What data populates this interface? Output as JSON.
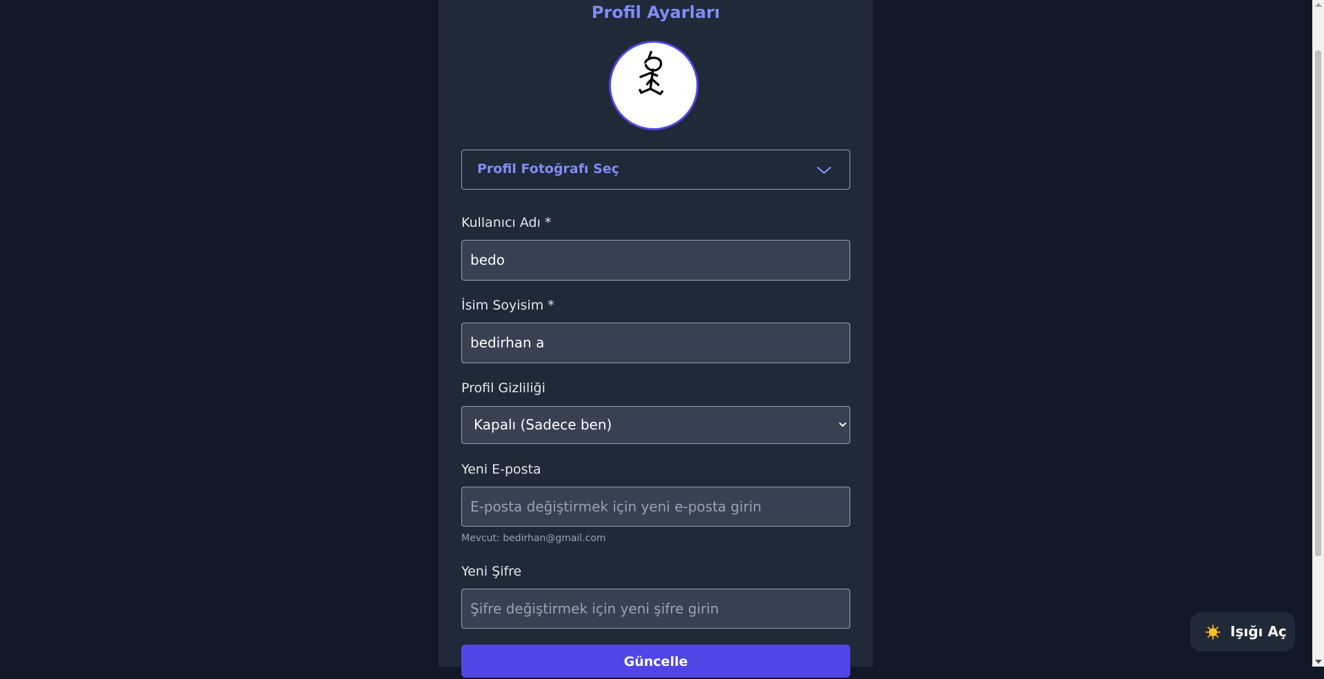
{
  "panel": {
    "title": "Profil Ayarları",
    "avatar_icon": "stick-figure",
    "photo_select_label": "Profil Fotoğrafı Seç"
  },
  "fields": {
    "username_label": "Kullanıcı Adı *",
    "username_value": "bedo",
    "fullname_label": "İsim Soyisim *",
    "fullname_value": "bedirhan a",
    "privacy_label": "Profil Gizliliği",
    "privacy_value": "Kapalı (Sadece ben)",
    "email_label": "Yeni E-posta",
    "email_placeholder": "E-posta değiştirmek için yeni e-posta girin",
    "email_current": "Mevcut: bedirhan@gmail.com",
    "password_label": "Yeni Şifre",
    "password_placeholder": "Şifre değiştirmek için yeni şifre girin"
  },
  "submit_label": "Güncelle",
  "theme_toggle": {
    "icon": "sun-icon",
    "label": "Işığı Aç"
  },
  "colors": {
    "accent": "#818cf8",
    "primary": "#4f46e5",
    "page_bg": "#111827",
    "panel_bg": "#1f2937"
  }
}
